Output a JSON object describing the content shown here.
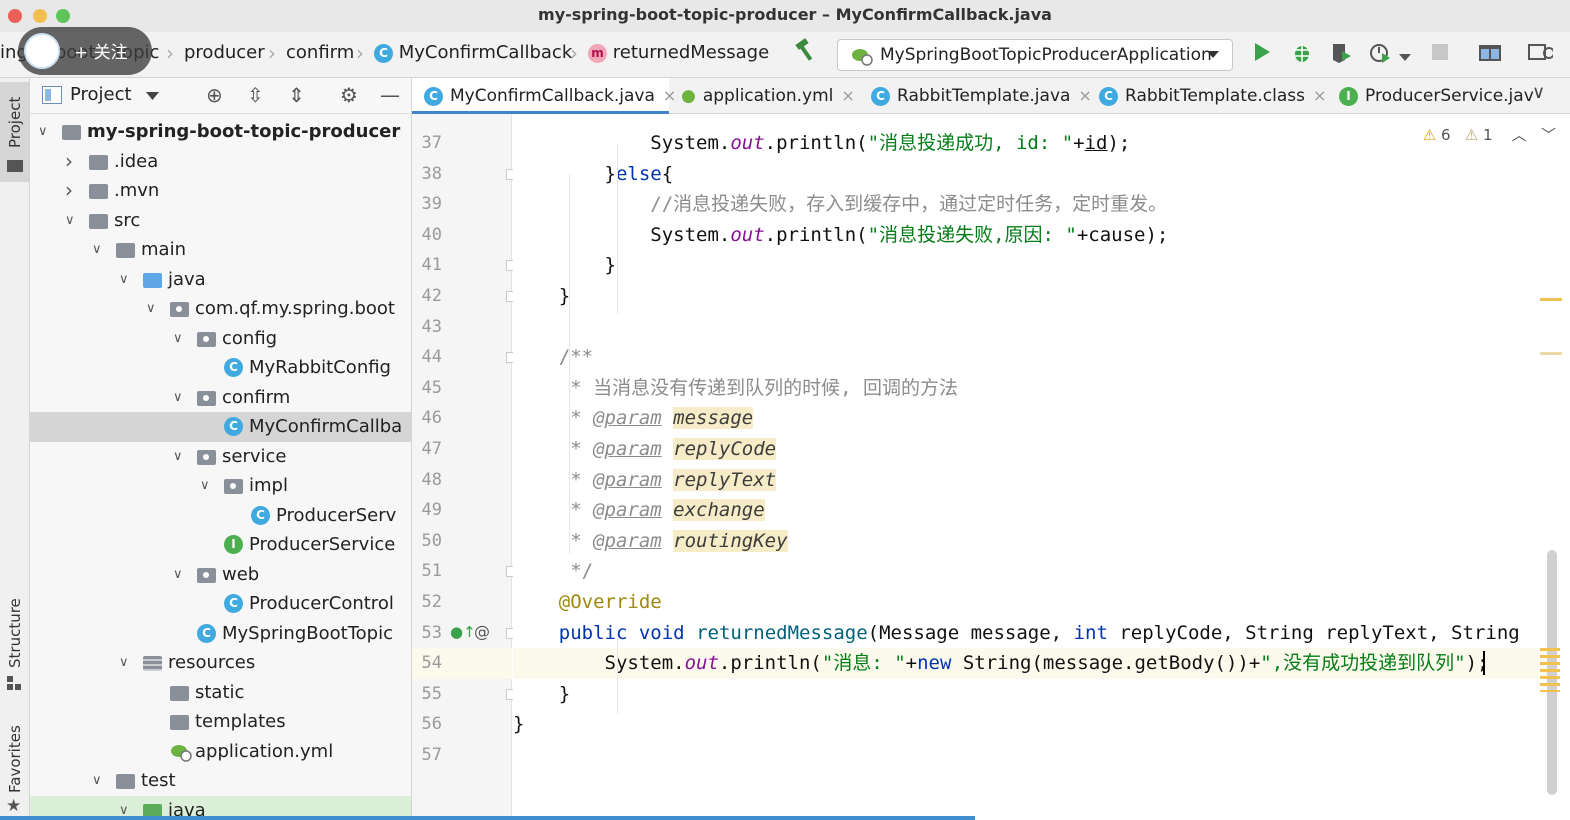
{
  "window": {
    "title": "my-spring-boot-topic-producer – MyConfirmCallback.java",
    "colors": {
      "close": "#ee5f57",
      "minimize": "#f4bd4f",
      "maximize": "#5ec659"
    }
  },
  "overlay": {
    "follow_label": "+ 关注"
  },
  "breadcrumb": {
    "items": [
      {
        "label": "ing",
        "icon": ""
      },
      {
        "label": "boot",
        "icon": ""
      },
      {
        "label": "topic",
        "icon": ""
      },
      {
        "label": "producer",
        "icon": ""
      },
      {
        "label": "confirm",
        "icon": ""
      },
      {
        "label": "MyConfirmCallback",
        "icon": "class-icon"
      },
      {
        "label": "returnedMessage",
        "icon": "method-icon"
      }
    ]
  },
  "run_config": {
    "label": "MySpringBootTopicProducerApplication"
  },
  "toolbar": {
    "icons": [
      "build-hammer-icon",
      "run-icon",
      "debug-icon",
      "coverage-icon",
      "profile-icon",
      "stop-icon",
      "project-structure-icon"
    ]
  },
  "left_strip": {
    "project": "Project",
    "structure": "Structure",
    "favorites": "Favorites"
  },
  "project_panel": {
    "title": "Project",
    "tree": [
      {
        "label": "my-spring-boot-topic-producer",
        "level": 0,
        "arrow": "expanded",
        "icon": "module",
        "bold": true
      },
      {
        "label": ".idea",
        "level": 1,
        "arrow": "collapsed",
        "icon": "folder"
      },
      {
        "label": ".mvn",
        "level": 1,
        "arrow": "collapsed",
        "icon": "folder"
      },
      {
        "label": "src",
        "level": 1,
        "arrow": "expanded",
        "icon": "folder"
      },
      {
        "label": "main",
        "level": 2,
        "arrow": "expanded",
        "icon": "folder"
      },
      {
        "label": "java",
        "level": 3,
        "arrow": "expanded",
        "icon": "source-folder"
      },
      {
        "label": "com.qf.my.spring.boot",
        "level": 4,
        "arrow": "expanded",
        "icon": "package"
      },
      {
        "label": "config",
        "level": 5,
        "arrow": "expanded",
        "icon": "package"
      },
      {
        "label": "MyRabbitConfig",
        "level": 6,
        "arrow": "",
        "icon": "class"
      },
      {
        "label": "confirm",
        "level": 5,
        "arrow": "expanded",
        "icon": "package"
      },
      {
        "label": "MyConfirmCallba",
        "level": 6,
        "arrow": "",
        "icon": "class",
        "selected": true
      },
      {
        "label": "service",
        "level": 5,
        "arrow": "expanded",
        "icon": "package"
      },
      {
        "label": "impl",
        "level": 6,
        "arrow": "expanded",
        "icon": "package"
      },
      {
        "label": "ProducerServ",
        "level": 7,
        "arrow": "",
        "icon": "class"
      },
      {
        "label": "ProducerService",
        "level": 6,
        "arrow": "",
        "icon": "interface"
      },
      {
        "label": "web",
        "level": 5,
        "arrow": "expanded",
        "icon": "package"
      },
      {
        "label": "ProducerControl",
        "level": 6,
        "arrow": "",
        "icon": "class"
      },
      {
        "label": "MySpringBootTopic",
        "level": 5,
        "arrow": "",
        "icon": "spring-class"
      },
      {
        "label": "resources",
        "level": 3,
        "arrow": "expanded",
        "icon": "resources-folder"
      },
      {
        "label": "static",
        "level": 4,
        "arrow": "",
        "icon": "folder"
      },
      {
        "label": "templates",
        "level": 4,
        "arrow": "",
        "icon": "folder"
      },
      {
        "label": "application.yml",
        "level": 4,
        "arrow": "",
        "icon": "yml"
      },
      {
        "label": "test",
        "level": 2,
        "arrow": "expanded",
        "icon": "folder"
      },
      {
        "label": "java",
        "level": 3,
        "arrow": "expanded",
        "icon": "test-folder",
        "green": true
      }
    ]
  },
  "tabs": [
    {
      "label": "MyConfirmCallback.java",
      "icon": "class",
      "active": true,
      "closable": true
    },
    {
      "label": "application.yml",
      "icon": "yml",
      "closable": true
    },
    {
      "label": "RabbitTemplate.java",
      "icon": "class",
      "closable": true
    },
    {
      "label": "RabbitTemplate.class",
      "icon": "class",
      "closable": true
    },
    {
      "label": "ProducerService.jav",
      "icon": "interface",
      "closable": false
    }
  ],
  "inspections": {
    "warnings": "6",
    "weak_warnings": "1"
  },
  "editor": {
    "current_line": 54,
    "lines": [
      {
        "n": 37,
        "html": "            System.<span class=\"f\">out</span>.println(<span class=\"s\">\"消息投递成功, id: \"</span>+<u>id</u>);"
      },
      {
        "n": 38,
        "html": "        }<span class=\"k\">else</span>{"
      },
      {
        "n": 39,
        "html": "            <span class=\"c\">//消息投递失败，存入到缓存中，通过定时任务，定时重发。</span>"
      },
      {
        "n": 40,
        "html": "            System.<span class=\"f\">out</span>.println(<span class=\"s\">\"消息投递失败,原因: \"</span>+cause);"
      },
      {
        "n": 41,
        "html": "        }"
      },
      {
        "n": 42,
        "html": "    }"
      },
      {
        "n": 43,
        "html": ""
      },
      {
        "n": 44,
        "html": "    <span class=\"c\">/**</span>"
      },
      {
        "n": 45,
        "html": "<span class=\"c\">     * 当消息没有传递到队列的时候, 回调的方法</span>"
      },
      {
        "n": 46,
        "html": "<span class=\"c\">     * </span><span class=\"jd\">@param</span> <span class=\"pp\">message</span>"
      },
      {
        "n": 47,
        "html": "<span class=\"c\">     * </span><span class=\"jd\">@param</span> <span class=\"pp\">replyCode</span>"
      },
      {
        "n": 48,
        "html": "<span class=\"c\">     * </span><span class=\"jd\">@param</span> <span class=\"pp\">replyText</span>"
      },
      {
        "n": 49,
        "html": "<span class=\"c\">     * </span><span class=\"jd\">@param</span> <span class=\"pp\">exchange</span>"
      },
      {
        "n": 50,
        "html": "<span class=\"c\">     * </span><span class=\"jd\">@param</span> <span class=\"pp\">routingKey</span>"
      },
      {
        "n": 51,
        "html": "<span class=\"c\">     */</span>"
      },
      {
        "n": 52,
        "html": "    <span class=\"a\">@Override</span>"
      },
      {
        "n": 53,
        "html": "    <span class=\"k\">public void</span> <span class=\"mref\">returnedMessage</span>(Message message, <span class=\"k\">int</span> replyCode, String replyText, String"
      },
      {
        "n": 54,
        "html": "        System.<span class=\"f\">out</span>.println(<span class=\"s\">\"消息: \"</span>+<span class=\"k\">new</span> String(message.getBody())+<span class=\"s\">\",没有成功投递到队列\"</span>);"
      },
      {
        "n": 55,
        "html": "    }"
      },
      {
        "n": 56,
        "html": "}"
      },
      {
        "n": 57,
        "html": ""
      }
    ]
  }
}
